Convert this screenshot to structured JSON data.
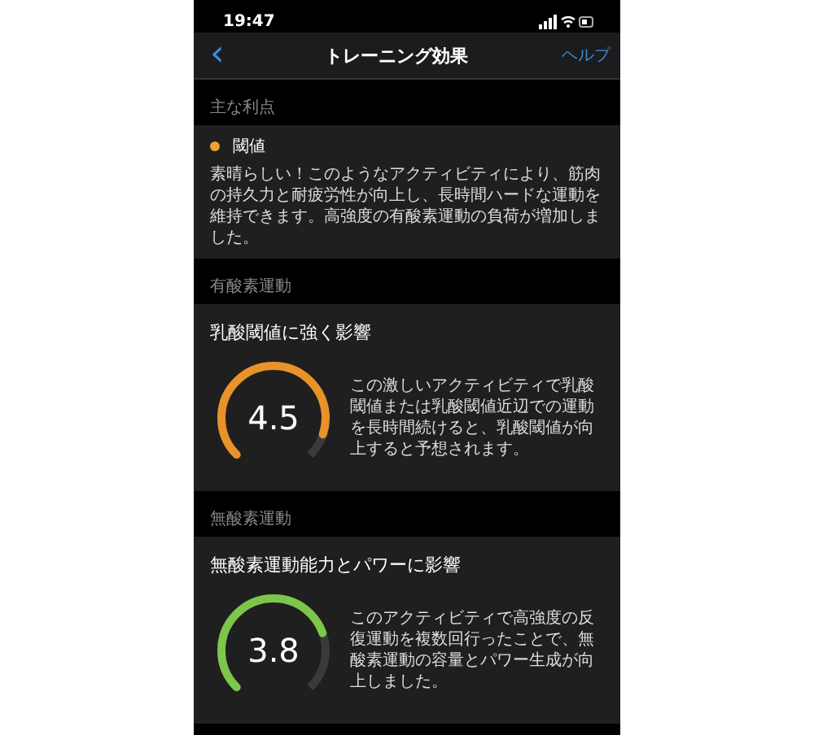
{
  "status_bar": {
    "time": "19:47"
  },
  "nav": {
    "back": "‹",
    "title": "トレーニング効果",
    "help": "ヘルプ"
  },
  "sections": [
    {
      "header": "主な利点",
      "kind": "benefit",
      "color": "#f0a030",
      "title": "閾値",
      "text": "素晴らしい！このようなアクティビティにより、筋肉の持久力と耐疲労性が向上し、長時間ハードな運動を維持できます。高強度の有酸素運動の負荷が増加しました。"
    },
    {
      "header": "有酸素運動",
      "kind": "gauge",
      "color": "#e8922a",
      "title": "乳酸閾値に強く影響",
      "value": "4.5",
      "level": 0.9,
      "text": "この激しいアクティビティで乳酸閾値または乳酸閾値近辺での運動を長時間続けると、乳酸閾値が向上すると予想されます。"
    },
    {
      "header": "無酸素運動",
      "kind": "gauge",
      "color": "#7cc74a",
      "title": "無酸素運動能力とパワーに影響",
      "value": "3.8",
      "level": 0.76,
      "text": "このアクティビティで高強度の反復運動を複数回行ったことで、無酸素運動の容量とパワー生成が向上しました。"
    }
  ]
}
